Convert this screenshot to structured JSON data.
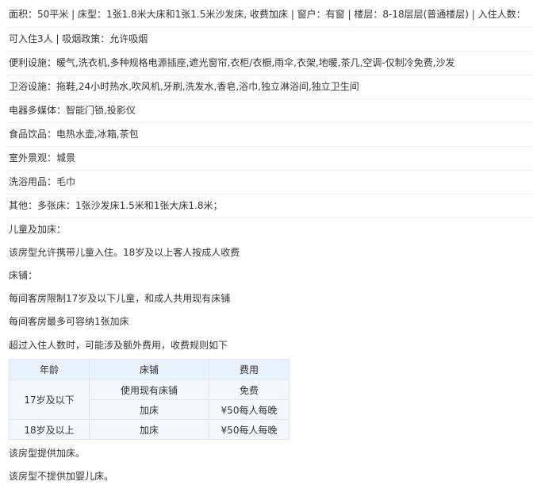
{
  "room_info": {
    "line1": "面积：50平米 | 床型：1张1.8米大床和1张1.5米沙发床, 收费加床 | 窗户：有窗 | 楼层：8-18层层(普通楼层) | 入住人数：",
    "line2": "可入住3人 | 吸烟政策：允许吸烟"
  },
  "facilities": [
    {
      "label": "便利设施：",
      "value": "暖气,洗衣机,多种规格电源插座,遮光窗帘,衣柜/衣橱,雨伞,衣架,地暖,茶几,空调-仅制冷免费,沙发"
    },
    {
      "label": "卫浴设施：",
      "value": "拖鞋,24小时热水,吹风机,牙刷,洗发水,香皂,浴巾,独立淋浴间,独立卫生间"
    },
    {
      "label": "电器多媒体：",
      "value": "智能门锁,投影仪"
    },
    {
      "label": "食品饮品：",
      "value": "电热水壶,冰箱,茶包"
    },
    {
      "label": "室外景观：",
      "value": "城景"
    },
    {
      "label": "洗浴用品：",
      "value": "毛巾"
    },
    {
      "label": "其他：",
      "value": "多张床：1张沙发床1.5米和1张大床1.8米；"
    }
  ],
  "policy": {
    "children_title": "儿童及加床：",
    "children_allowed": "该房型允许携带儿童入住。18岁及以上客人按成人收费",
    "bed_title": "床铺：",
    "bed_limit": "每间客房限制17岁及以下儿童，和成人共用现有床铺",
    "extra_bed_max": "每间客房最多可容纳1张加床",
    "over_capacity": "超过入住人数时，可能涉及额外费用，收费规则如下"
  },
  "table": {
    "headers": [
      "年龄",
      "床铺",
      "费用"
    ],
    "group1_age": "17岁及以下",
    "group1_rows": [
      {
        "bed": "使用现有床铺",
        "fee": "免费"
      },
      {
        "bed": "加床",
        "fee": "¥50每人每晚"
      }
    ],
    "group2": {
      "age": "18岁及以上",
      "bed": "加床",
      "fee": "¥50每人每晚"
    }
  },
  "footer": {
    "extra_bed": "该房型提供加床。",
    "no_crib": "该房型不提供加婴儿床。"
  },
  "colors": {
    "link": "#2a8ae6",
    "table_bg": "#f4f8fe",
    "table_header": "#e8f1fc"
  }
}
